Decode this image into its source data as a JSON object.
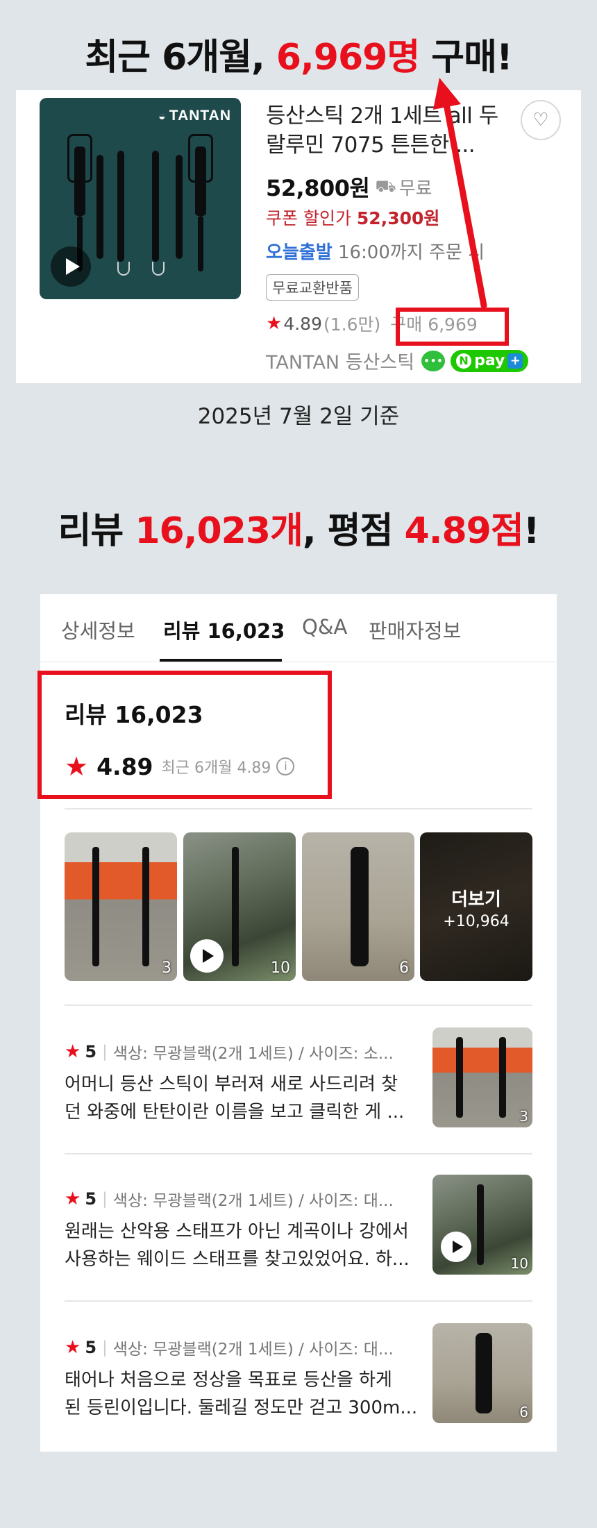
{
  "headline1": {
    "prefix": "최근 6개월, ",
    "highlight": "6,969명",
    "suffix": " 구매!"
  },
  "product": {
    "brand_logo": "TANTAN",
    "title": "등산스틱 2개 1세트 all 두랄루민 7075 튼튼한 ...",
    "price": "52,800원",
    "shipping": "무료",
    "coupon_label": "쿠폰 할인가",
    "coupon_price": "52,300원",
    "delivery_badge": "오늘출발",
    "delivery_text": "16:00까지 주문 시",
    "tag": "무료교환반품",
    "rating": "4.89",
    "rating_count": "(1.6만)",
    "purchase_count": "구매 6,969",
    "store_name": "TANTAN 등산스틱",
    "npay_label": "pay"
  },
  "as_of_date": "2025년 7월 2일 기준",
  "headline2": {
    "part1": "리뷰 ",
    "highlight1": "16,023개",
    "part2": ", 평점 ",
    "highlight2": "4.89점",
    "part3": "!"
  },
  "tabs": [
    "상세정보",
    "리뷰 16,023",
    "Q&A",
    "판매자정보"
  ],
  "review_summary": {
    "title": "리뷰 16,023",
    "score": "4.89",
    "recent": "최근 6개월 4.89"
  },
  "photos": [
    {
      "count": "3"
    },
    {
      "count": "10"
    },
    {
      "count": "6"
    },
    {
      "more_label": "더보기",
      "more_count": "+10,964"
    }
  ],
  "reviews": [
    {
      "score": "5",
      "option": "색상: 무광블랙(2개 1세트) / 사이즈: 소...",
      "line1": "어머니 등산 스틱이 부러져 새로 사드리려 찾",
      "line2": "던 와중에 탄탄이란 이름을 보고 클릭한 게 ...",
      "thumb_count": "3"
    },
    {
      "score": "5",
      "option": "색상: 무광블랙(2개 1세트) / 사이즈: 대...",
      "line1": "원래는 산악용 스태프가 아닌 계곡이나 강에서",
      "line2": "사용하는 웨이드 스태프를 찾고있었어요. 하...",
      "thumb_count": "10"
    },
    {
      "score": "5",
      "option": "색상: 무광블랙(2개 1세트) / 사이즈: 대...",
      "line1": "태어나 처음으로 정상을 목표로 등산을 하게",
      "line2": "된 등린이입니다. 둘레길 정도만 걷고 300m...",
      "thumb_count": "6"
    }
  ],
  "colors": {
    "accent_red": "#e8101c",
    "background": "#dfe5e8",
    "link_blue": "#2e6fd8",
    "npay_green": "#1ec800"
  }
}
